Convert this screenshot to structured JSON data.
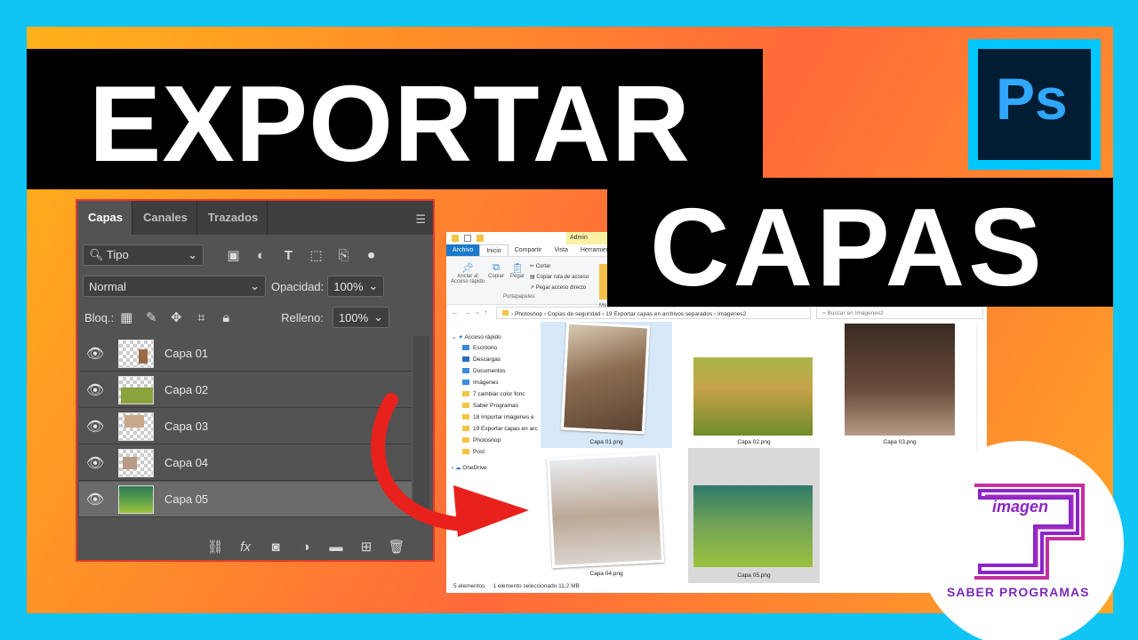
{
  "title": {
    "line1": "EXPORTAR",
    "line2": "CAPAS"
  },
  "ps_logo": {
    "text": "Ps"
  },
  "layers_panel": {
    "tabs": [
      "Capas",
      "Canales",
      "Trazados"
    ],
    "filter_kind": "Tipo",
    "blend_mode": "Normal",
    "opacity_label": "Opacidad:",
    "opacity_value": "100%",
    "lock_label": "Bloq.:",
    "fill_label": "Relleno:",
    "fill_value": "100%",
    "layers": [
      "Capa 01",
      "Capa 02",
      "Capa 03",
      "Capa 04",
      "Capa 05"
    ],
    "selected_layer": "Capa 05"
  },
  "explorer": {
    "ribbon_tabs": [
      "Archivo",
      "Inicio",
      "Compartir",
      "Vista",
      "Herramientas"
    ],
    "highlight_tab": "Admin",
    "ribbon": {
      "pin": "Anclar al Acceso rápido",
      "copy": "Copiar",
      "paste": "Pegar",
      "cut": "Cortar",
      "copy_path": "Copiar ruta de acceso",
      "paste_shortcut": "Pegar acceso directo",
      "group": "Portapapeles",
      "move": "Mo"
    },
    "path": [
      "Photoshop",
      "Copias de seguridad",
      "19 Exportar capas en archivos separados",
      "Imagenes2"
    ],
    "search_placeholder": "Buscar en Imagenes2",
    "nav": {
      "quick_access": "Acceso rápido",
      "items": [
        "Escritorio",
        "Descargas",
        "Documentos",
        "Imágenes",
        "7 cambiar color fonc",
        "Saber Programas",
        "18 Importar imagenes e",
        "19 Exportar capas en arc",
        "Photoshop",
        "Post"
      ],
      "onedrive": "OneDrive"
    },
    "files": [
      "Capa 01.png",
      "Capa 02.png",
      "Capa 03.png",
      "Capa 04.png",
      "Capa 05.png"
    ],
    "status": {
      "count": "5 elementos",
      "selected": "1 elemento seleccionado  11,2 MB"
    }
  },
  "brand": {
    "word": "imagen",
    "name": "SABER PROGRAMAS"
  }
}
